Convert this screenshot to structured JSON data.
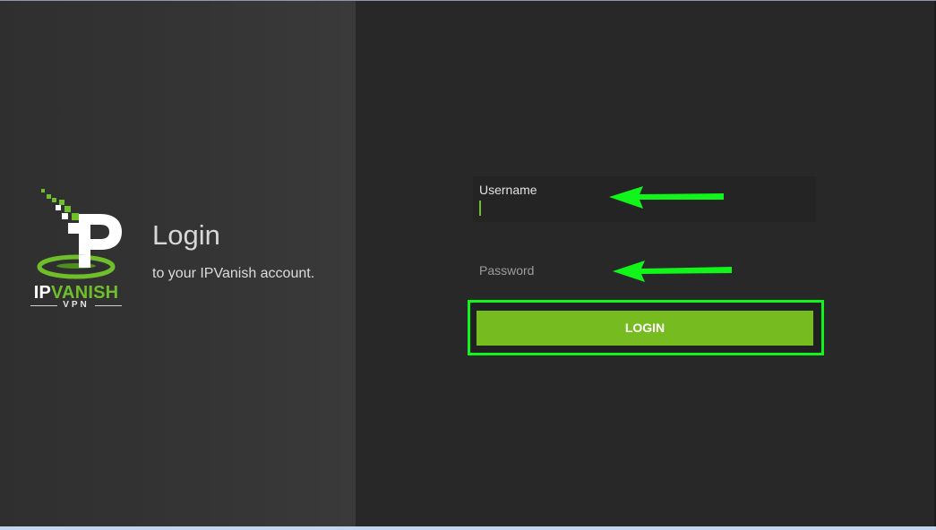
{
  "brand": {
    "logo_word_ip": "IP",
    "logo_word_vanish": "VANISH",
    "logo_sub": "VPN",
    "green": "#6fbf2a"
  },
  "header": {
    "title": "Login",
    "subtitle": "to your IPVanish account."
  },
  "form": {
    "username_label": "Username",
    "username_value": "",
    "password_placeholder": "Password",
    "login_label": "LOGIN",
    "button_color": "#76bc21"
  },
  "annotations": {
    "highlight_color": "#12f51a",
    "arrow_color": "#12f51a"
  }
}
